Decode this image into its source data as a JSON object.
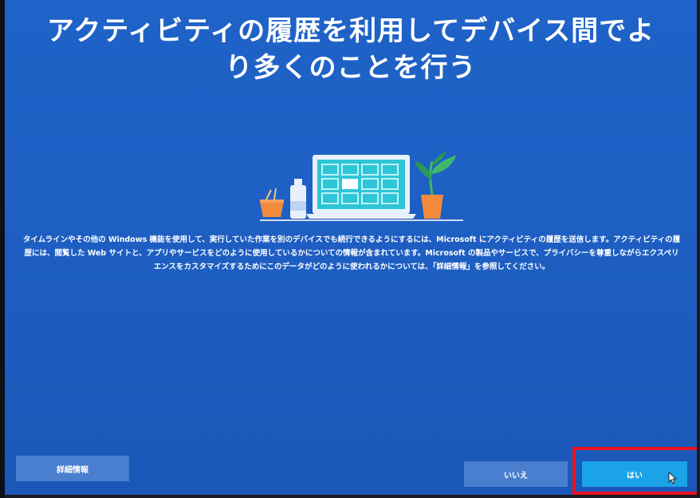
{
  "setup": {
    "title_line1": "アクティビティの履歴を利用してデバイス間でよ",
    "title_line2": "り多くのことを行う",
    "description": "タイムラインやその他の Windows 機能を使用して、実行していた作業を別のデバイスでも続行できるようにするには、Microsoft にアクティビティの履歴を送信します。アクティビティの履歴には、閲覧した Web サイトと、アプリやサービスをどのように使用しているかについての情報が含まれています。Microsoft の製品やサービスで、プライバシーを尊重しながらエクスペリエンスをカスタマイズするためにこのデータがどのように使われるかについては、「詳細情報」を参照してください。"
  },
  "buttons": {
    "details_label": "詳細情報",
    "no_label": "いいえ",
    "yes_label": "はい"
  },
  "colors": {
    "background": "#1f63c8",
    "button": "#4a7fd0",
    "primary_button": "#1aa3e8",
    "highlight": "#e8141e"
  },
  "icons": {
    "illustration": "laptop-with-plant-and-cup-illustration",
    "cursor": "mouse-pointer-icon"
  }
}
